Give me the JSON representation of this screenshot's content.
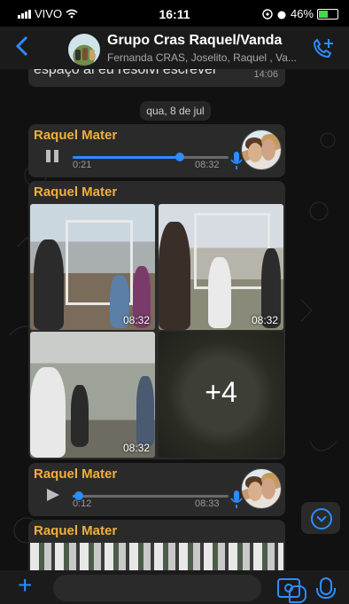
{
  "status_bar": {
    "carrier": "VIVO",
    "time": "16:11",
    "battery": "46%"
  },
  "header": {
    "back_icon": "chevron-left-icon",
    "title": "Grupo Cras Raquel/Vanda",
    "subtitle": "Fernanda CRAS, Joselito, Raquel , Va...",
    "call_icon": "call-add-icon"
  },
  "messages": {
    "partial": {
      "text": "espaço ai eu resolvi escrever",
      "time": "14:06"
    },
    "date_separator": "qua, 8 de jul",
    "audio1": {
      "sender": "Raquel Mater",
      "elapsed": "0:21",
      "time": "08:32",
      "state": "paused",
      "progress": 0.69
    },
    "gallery": {
      "sender": "Raquel Mater",
      "tile_times": [
        "08:32",
        "08:32",
        "08:32"
      ],
      "more_count": "+4"
    },
    "audio2": {
      "sender": "Raquel Mater",
      "elapsed": "0:12",
      "time": "08:33",
      "state": "stopped",
      "progress": 0.04
    },
    "partial_bottom": {
      "sender": "Raquel Mater"
    }
  },
  "colors": {
    "accent": "#2d8cff",
    "sender": "#f0b03a",
    "bubble": "#2a2a2a",
    "background": "#111111"
  }
}
